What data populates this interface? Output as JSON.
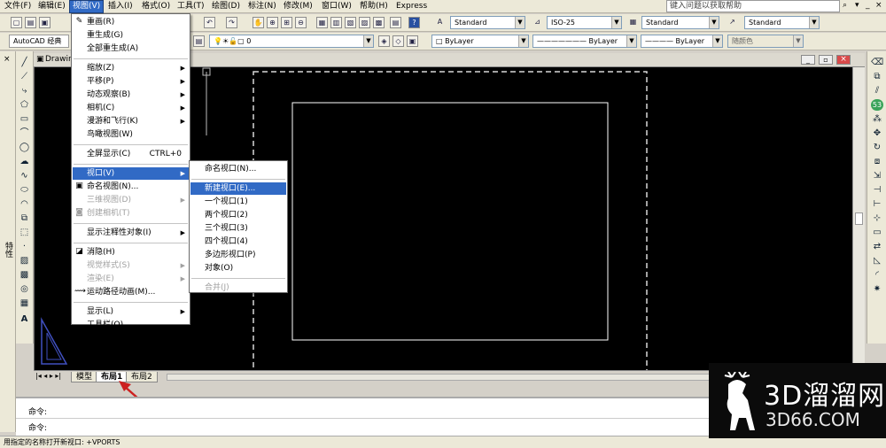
{
  "menubar": {
    "items": [
      "文件(F)",
      "编辑(E)",
      "视图(V)",
      "插入(I)",
      "格式(O)",
      "工具(T)",
      "绘图(D)",
      "标注(N)",
      "修改(M)",
      "窗口(W)",
      "帮助(H)",
      "Express"
    ],
    "help_search_placeholder": "键入问题以获取帮助"
  },
  "toolbar": {
    "workspace": "AutoCAD 经典",
    "layer_value": "0",
    "text_style": "Standard",
    "dim_style": "ISO-25",
    "table_style": "Standard",
    "mleader_style": "Standard",
    "color": "ByLayer",
    "linetype": "ByLayer",
    "lineweight": "ByLayer",
    "plot_style": "随颜色"
  },
  "drawing": {
    "title": "Drawing"
  },
  "view_menu": {
    "items": [
      {
        "label": "重画(R)",
        "disabled": false,
        "submenu": false,
        "shortcut": "",
        "icon": "redraw-icon"
      },
      {
        "label": "重生成(G)",
        "disabled": false,
        "submenu": false,
        "shortcut": "",
        "icon": ""
      },
      {
        "label": "全部重生成(A)",
        "disabled": false,
        "submenu": false,
        "shortcut": "",
        "icon": ""
      },
      {
        "label": "缩放(Z)",
        "disabled": false,
        "submenu": true,
        "shortcut": "",
        "icon": ""
      },
      {
        "label": "平移(P)",
        "disabled": false,
        "submenu": true,
        "shortcut": "",
        "icon": ""
      },
      {
        "label": "动态观察(B)",
        "disabled": false,
        "submenu": true,
        "shortcut": "",
        "icon": ""
      },
      {
        "label": "相机(C)",
        "disabled": false,
        "submenu": true,
        "shortcut": "",
        "icon": ""
      },
      {
        "label": "漫游和飞行(K)",
        "disabled": false,
        "submenu": true,
        "shortcut": "",
        "icon": ""
      },
      {
        "label": "鸟瞰视图(W)",
        "disabled": false,
        "submenu": false,
        "shortcut": "",
        "icon": ""
      },
      {
        "label": "全屏显示(C)",
        "disabled": false,
        "submenu": false,
        "shortcut": "CTRL+0",
        "icon": ""
      },
      {
        "label": "视口(V)",
        "disabled": false,
        "submenu": true,
        "shortcut": "",
        "icon": ""
      },
      {
        "label": "命名视图(N)...",
        "disabled": false,
        "submenu": false,
        "shortcut": "",
        "icon": "named-view-icon"
      },
      {
        "label": "三维视图(D)",
        "disabled": true,
        "submenu": true,
        "shortcut": "",
        "icon": ""
      },
      {
        "label": "创建相机(T)",
        "disabled": true,
        "submenu": false,
        "shortcut": "",
        "icon": "camera-icon"
      },
      {
        "label": "显示注释性对象(I)",
        "disabled": false,
        "submenu": true,
        "shortcut": "",
        "icon": ""
      },
      {
        "label": "消隐(H)",
        "disabled": false,
        "submenu": false,
        "shortcut": "",
        "icon": "hide-icon"
      },
      {
        "label": "视觉样式(S)",
        "disabled": true,
        "submenu": true,
        "shortcut": "",
        "icon": ""
      },
      {
        "label": "渲染(E)",
        "disabled": true,
        "submenu": true,
        "shortcut": "",
        "icon": ""
      },
      {
        "label": "运动路径动画(M)...",
        "disabled": false,
        "submenu": false,
        "shortcut": "",
        "icon": "motion-path-icon"
      },
      {
        "label": "显示(L)",
        "disabled": false,
        "submenu": true,
        "shortcut": "",
        "icon": ""
      },
      {
        "label": "工具栏(O)...",
        "disabled": false,
        "submenu": false,
        "shortcut": "",
        "icon": ""
      }
    ]
  },
  "viewport_submenu": {
    "items": [
      {
        "label": "命名视口(N)...",
        "disabled": false
      },
      {
        "label": "新建视口(E)...",
        "disabled": false
      },
      {
        "label": "一个视口(1)",
        "disabled": false
      },
      {
        "label": "两个视口(2)",
        "disabled": false
      },
      {
        "label": "三个视口(3)",
        "disabled": false
      },
      {
        "label": "四个视口(4)",
        "disabled": false
      },
      {
        "label": "多边形视口(P)",
        "disabled": false
      },
      {
        "label": "对象(O)",
        "disabled": false
      },
      {
        "label": "合并(J)",
        "disabled": true
      }
    ],
    "highlighted_index": 1
  },
  "layout_tabs": [
    "模型",
    "布局1",
    "布局2"
  ],
  "selected_tab": "布局1",
  "command": {
    "line1_prompt": "命令:",
    "line2_prompt": "命令:"
  },
  "statusbar": {
    "text": "用指定的名称打开新视口:  +VPORTS"
  },
  "left_panel_label": "特性",
  "watermark": {
    "title": "3D溜溜网",
    "url": "3D66.COM"
  },
  "accent_colors": {
    "highlight": "#316ac5",
    "arrow_red": "#cc2020"
  }
}
